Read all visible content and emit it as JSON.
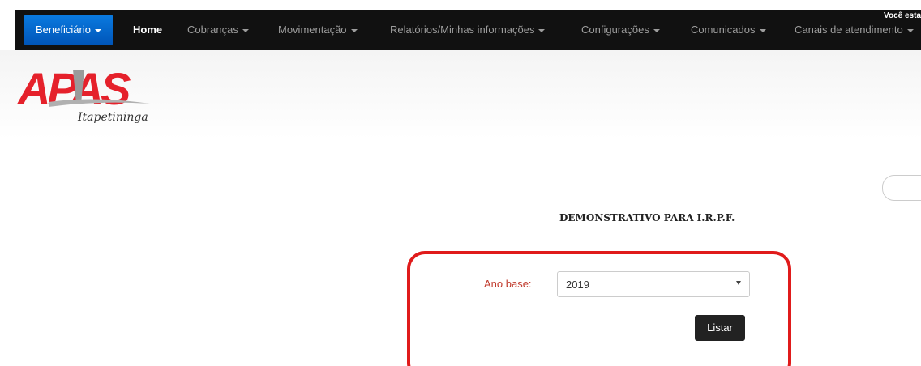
{
  "navbar": {
    "beneficiario_label": "Beneficiário",
    "home_label": "Home",
    "cobrancas_label": "Cobranças",
    "movimentacao_label": "Movimentação",
    "relatorios_label": "Relatórios/Minhas informações",
    "configuracoes_label": "Configurações",
    "comunicados_label": "Comunicados",
    "canais_label": "Canais de atendimento",
    "voce_esta_text": "Você esta"
  },
  "logo": {
    "brand_text": "APAS",
    "city_text": "Itapetininga"
  },
  "report": {
    "title": "DEMONSTRATIVO PARA I.R.P.F.",
    "ano_base_label": "Ano base:",
    "ano_base_value": "2019",
    "list_button_label": "Listar"
  },
  "colors": {
    "navbar_bg": "#111111",
    "active_blue": "#0066cc",
    "highlight_red": "#e01b1b",
    "label_red": "#c0392b",
    "button_dark": "#222222"
  }
}
